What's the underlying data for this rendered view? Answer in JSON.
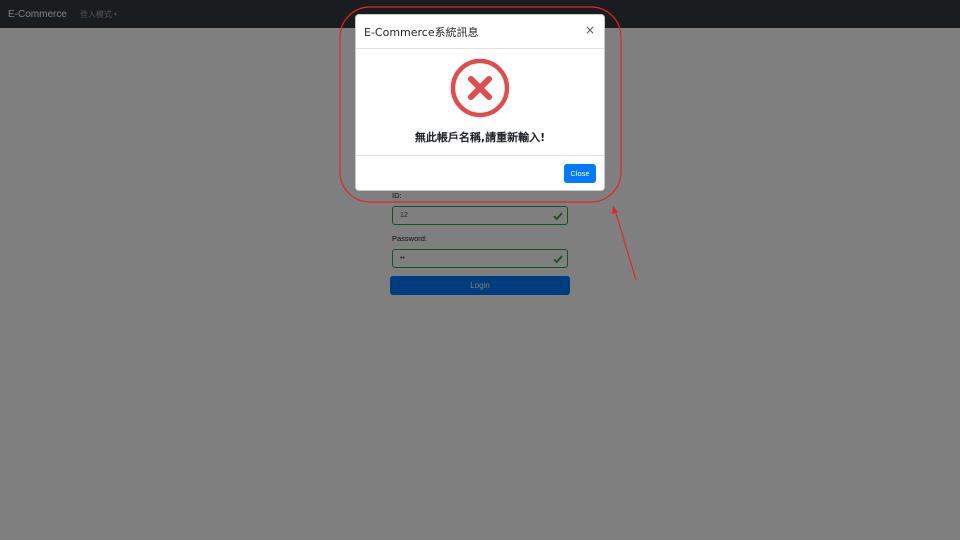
{
  "navbar": {
    "brand": "E-Commerce",
    "dropdown_label": "登入模式",
    "caret": "▾"
  },
  "login": {
    "id_label": "ID:",
    "id_value": "12",
    "password_label": "Password:",
    "password_value": "••",
    "login_label": "Login"
  },
  "modal": {
    "title": "E-Commerce系統訊息",
    "close_symbol": "×",
    "message": "無此帳戶名稱,請重新輸入!",
    "close_label": "Close"
  },
  "colors": {
    "navbar": "#343a40",
    "primary": "#007bff",
    "success": "#28a745",
    "error": "#e04c4c",
    "annotation": "#e52424"
  },
  "icons": {
    "error": "error-x-circle-icon",
    "valid": "check-icon"
  }
}
